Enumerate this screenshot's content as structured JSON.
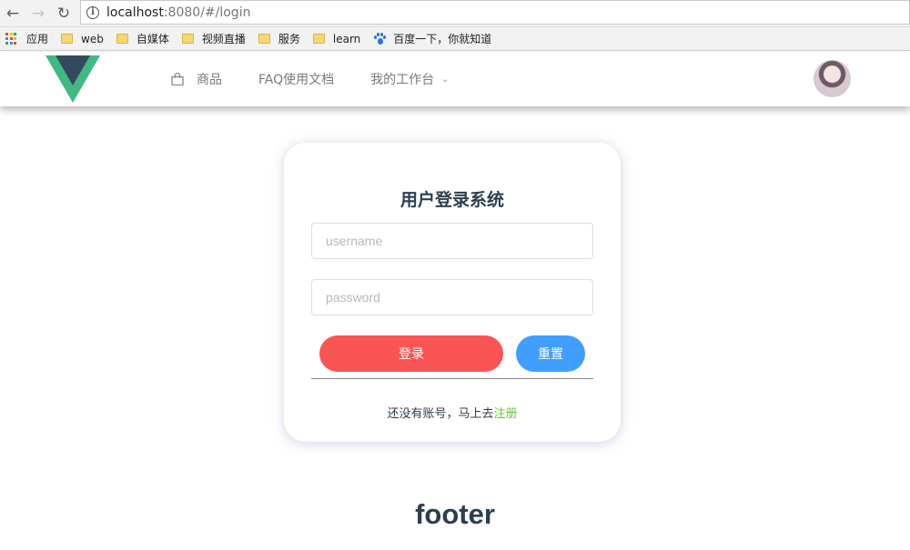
{
  "browser": {
    "url_host": "localhost",
    "url_rest": ":8080/#/login",
    "bookmarks": [
      {
        "label": "应用",
        "icon": "apps-icon"
      },
      {
        "label": "web",
        "icon": "folder-icon"
      },
      {
        "label": "自媒体",
        "icon": "folder-icon"
      },
      {
        "label": "视频直播",
        "icon": "folder-icon"
      },
      {
        "label": "服务",
        "icon": "folder-icon"
      },
      {
        "label": "learn",
        "icon": "folder-icon"
      },
      {
        "label": "百度一下，你就知道",
        "icon": "baidu-paw-icon"
      }
    ]
  },
  "header": {
    "nav": {
      "products": "商品",
      "faq": "FAQ使用文档",
      "workbench": "我的工作台"
    }
  },
  "login": {
    "title": "用户登录系统",
    "username_placeholder": "username",
    "password_placeholder": "password",
    "login_button": "登录",
    "reset_button": "重置",
    "register_prompt": "还没有账号，马上去",
    "register_link": "注册"
  },
  "footer": {
    "text": "footer"
  },
  "colors": {
    "login_button": "#fa5555",
    "reset_button": "#409eff",
    "register_link": "#67c23a",
    "vue_green": "#42b883",
    "vue_dark": "#35495e"
  }
}
